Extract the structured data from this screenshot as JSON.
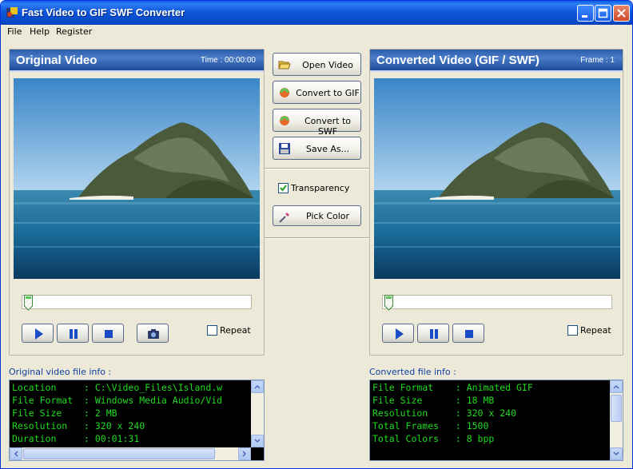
{
  "window": {
    "title": "Fast Video to GIF SWF Converter"
  },
  "menu": [
    "File",
    "Help",
    "Register"
  ],
  "original": {
    "title": "Original Video",
    "time": "Time : 00:00:00",
    "repeat_label": "Repeat",
    "info_label": "Original video file info :",
    "info_rows": [
      "Location     : C:\\Video_Files\\Island.w",
      "File Format  : Windows Media Audio/Vid",
      "File Size    : 2 MB",
      "Resolution   : 320 x 240",
      "Duration     : 00:01:31"
    ]
  },
  "converted": {
    "title": "Converted Video (GIF / SWF)",
    "frame": "Frame : 1",
    "repeat_label": "Repeat",
    "info_label": "Converted file info :",
    "info_rows": [
      "File Format    : Animated GIF",
      "File Size      : 18 MB",
      "Resolution     : 320 x 240",
      "Total Frames   : 1500",
      "Total Colors   : 8 bpp"
    ]
  },
  "actions": {
    "open": "Open Video",
    "to_gif": "Convert to GIF",
    "to_swf": "Convert to SWF",
    "save": "Save As...",
    "transparency": "Transparency",
    "pick_color": "Pick Color"
  },
  "colors": {
    "info_text": "#1fdc1f",
    "header_blue": "#2a5caa"
  }
}
